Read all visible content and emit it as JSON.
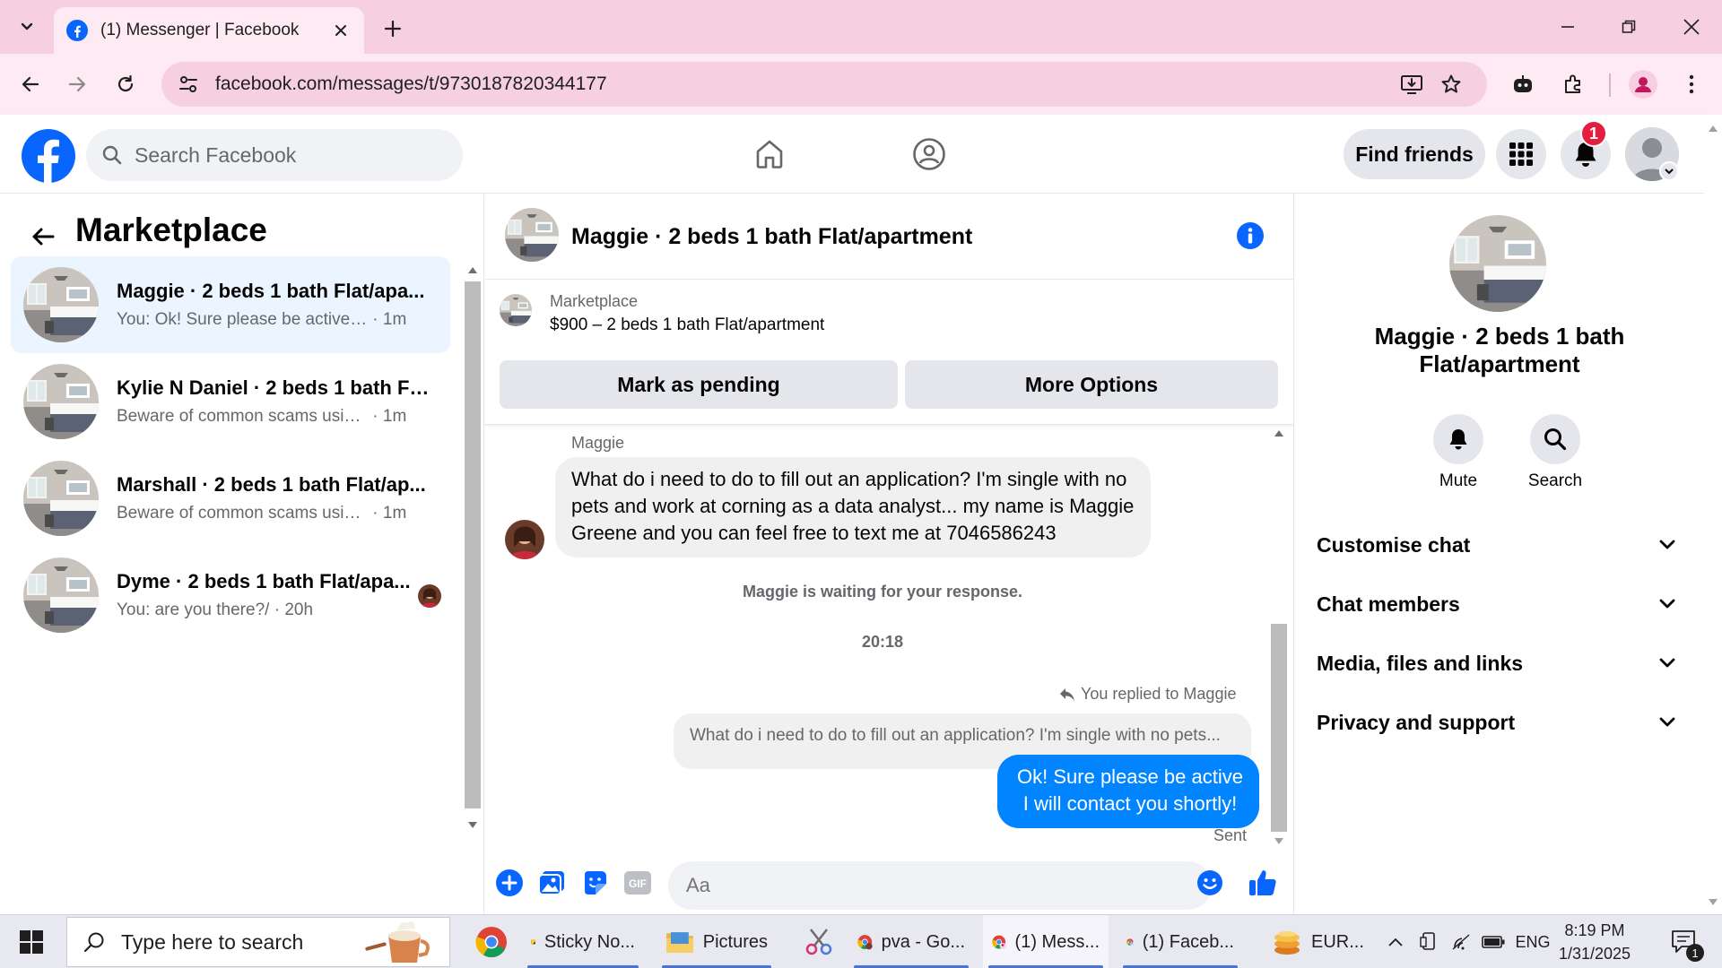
{
  "browser": {
    "tab_title": "(1) Messenger | Facebook",
    "url": "facebook.com/messages/t/9730187820344177"
  },
  "fb_header": {
    "search_placeholder": "Search Facebook",
    "find_friends_label": "Find friends",
    "notification_count": "1"
  },
  "left_panel": {
    "title": "Marketplace",
    "conversations": [
      {
        "name": "Maggie · 2 beds 1 bath Flat/apa...",
        "snippet": "You: Ok! Sure please be active I wil...",
        "time": "· 1m",
        "active": true
      },
      {
        "name": "Kylie N Daniel · 2 beds 1 bath Fl...",
        "snippet": "Beware of common scams using p...",
        "time": "· 1m",
        "active": false
      },
      {
        "name": "Marshall · 2 beds 1 bath Flat/ap...",
        "snippet": "Beware of common scams using p...",
        "time": "· 1m",
        "active": false
      },
      {
        "name": "Dyme · 2 beds 1 bath Flat/apa...",
        "snippet": "You: are you there?/",
        "time": "· 20h",
        "active": false
      }
    ]
  },
  "chat": {
    "title": "Maggie · 2 beds 1 bath Flat/apartment",
    "listing": {
      "label": "Marketplace",
      "price_line": "$900 – 2 beds 1 bath Flat/apartment",
      "mark_pending_label": "Mark as pending",
      "more_options_label": "More Options"
    },
    "sender_name": "Maggie",
    "incoming_message": "What do i need to do to fill out an application? I'm single with no pets and work at corning as a data analyst... my name is Maggie Greene and you can feel free to text me at 7046586243",
    "waiting_note": "Maggie is waiting for your response.",
    "timestamp": "20:18",
    "replied_label": "You replied to Maggie",
    "quoted_message": "What do i need to do to fill out an application? I'm single with no pets...",
    "sent_message": "Ok! Sure please be active I will contact you shortly!",
    "sent_status": "Sent",
    "composer_placeholder": "Aa"
  },
  "right_panel": {
    "title": "Maggie · 2 beds 1 bath Flat/apartment",
    "mute_label": "Mute",
    "search_label": "Search",
    "sections": [
      "Customise chat",
      "Chat members",
      "Media, files and links",
      "Privacy and support"
    ]
  },
  "taskbar": {
    "search_placeholder": "Type here to search",
    "items": [
      "Sticky No...",
      "Pictures",
      "pva - Go...",
      "(1) Mess...",
      "(1) Faceb..."
    ],
    "currency": "EUR...",
    "language": "ENG",
    "time": "8:19 PM",
    "date": "1/31/2025",
    "notification_count": "1"
  },
  "colors": {
    "brand_blue": "#0866ff",
    "messenger_blue": "#0084ff",
    "chrome_pink": "#f6cfe1",
    "notif_red": "#e41e3f"
  }
}
